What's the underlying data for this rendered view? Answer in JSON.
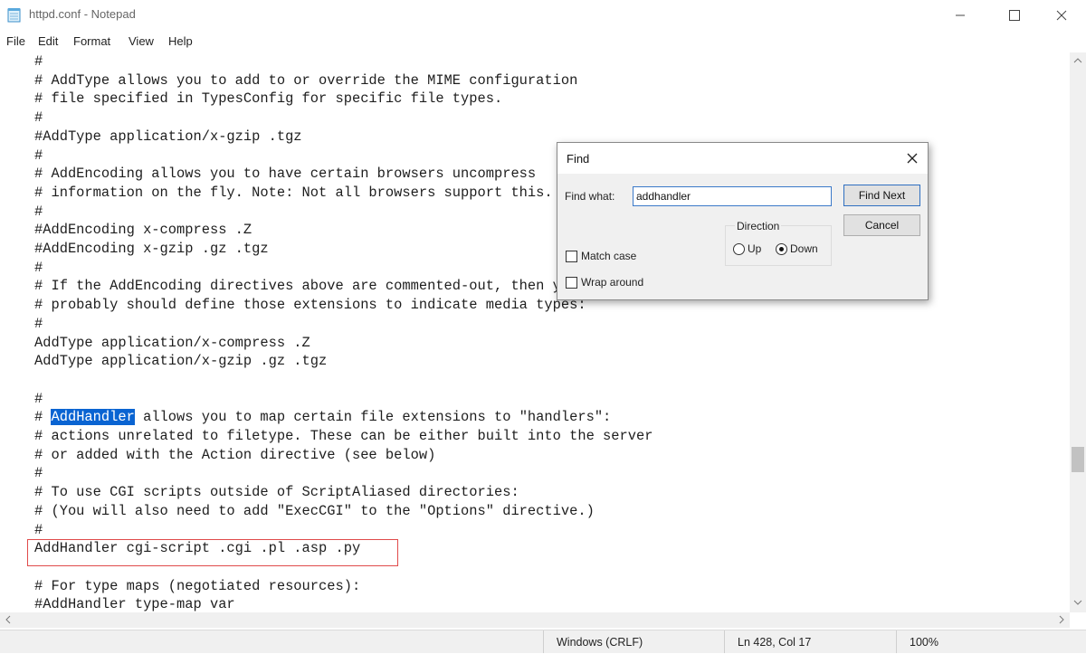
{
  "window": {
    "title": "httpd.conf - Notepad"
  },
  "menu": [
    "File",
    "Edit",
    "Format",
    "View",
    "Help"
  ],
  "editor": {
    "lines": [
      "#",
      "# AddType allows you to add to or override the MIME configuration",
      "# file specified in TypesConfig for specific file types.",
      "#",
      "#AddType application/x-gzip .tgz",
      "#",
      "# AddEncoding allows you to have certain browsers uncompress",
      "# information on the fly. Note: Not all browsers support this.",
      "#",
      "#AddEncoding x-compress .Z",
      "#AddEncoding x-gzip .gz .tgz",
      "#",
      "# If the AddEncoding directives above are commented-out, then you",
      "# probably should define those extensions to indicate media types:",
      "#",
      "AddType application/x-compress .Z",
      "AddType application/x-gzip .gz .tgz",
      "",
      "#",
      "# ",
      "# actions unrelated to filetype. These can be either built into the server",
      "# or added with the Action directive (see below)",
      "#",
      "# To use CGI scripts outside of ScriptAliased directories:",
      "# (You will also need to add \"ExecCGI\" to the \"Options\" directive.)",
      "#",
      "AddHandler cgi-script .cgi .pl .asp .py",
      "",
      "# For type maps (negotiated resources):",
      "#AddHandler type-map var"
    ],
    "selection": {
      "text": "AddHandler",
      "rest": " allows you to map certain file extensions to \"handlers\":"
    }
  },
  "status": {
    "encoding": "Windows (CRLF)",
    "position": "Ln 428, Col 17",
    "zoom": "100%"
  },
  "find_dialog": {
    "title": "Find",
    "find_what_label": "Find what:",
    "find_what_value": "addhandler",
    "find_next_label": "Find Next",
    "cancel_label": "Cancel",
    "direction_label": "Direction",
    "up_label": "Up",
    "down_label": "Down",
    "direction_selected": "Down",
    "match_case_label": "Match case",
    "match_case_checked": false,
    "wrap_around_label": "Wrap around",
    "wrap_around_checked": false
  }
}
